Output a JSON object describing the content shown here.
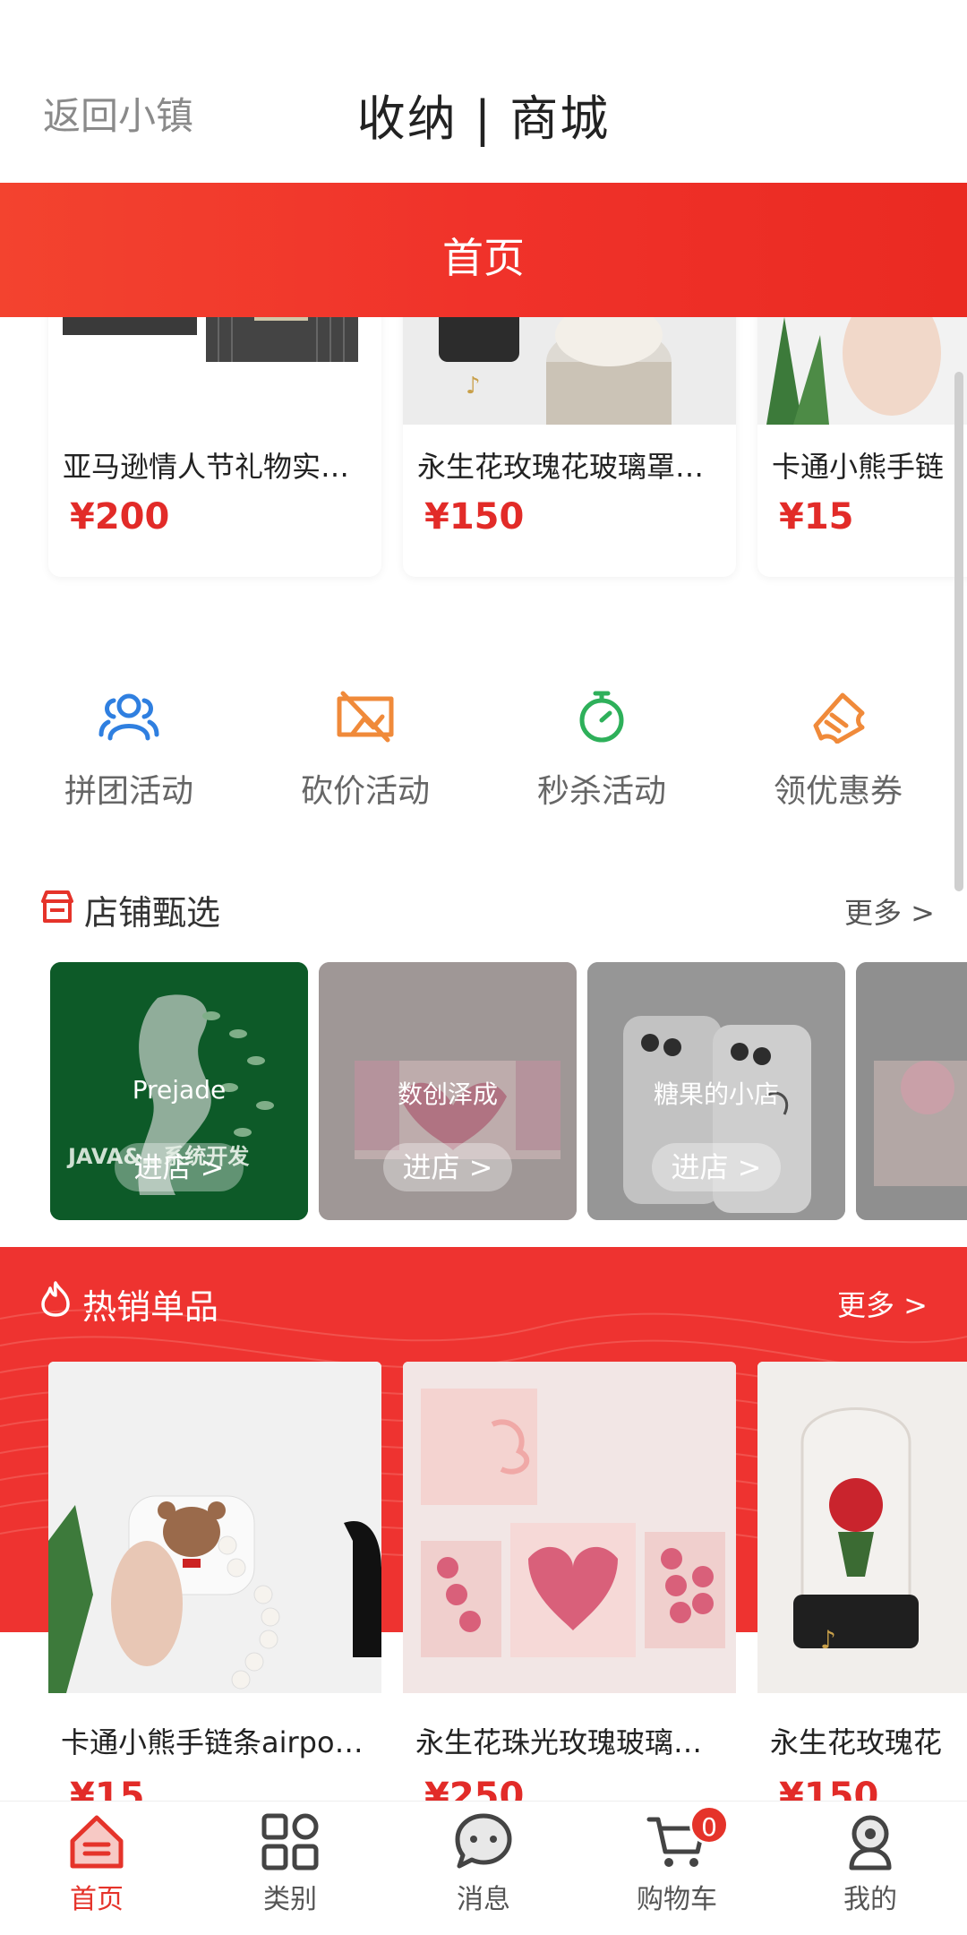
{
  "header": {
    "back_label": "返回小镇",
    "title": "收纳 | 商城",
    "band_title": "首页"
  },
  "top_products": [
    {
      "name": "亚马逊情人节礼物实用...",
      "price": "¥200"
    },
    {
      "name": "永生花玫瑰花玻璃罩成...",
      "price": "¥150"
    },
    {
      "name": "卡通小熊手链",
      "price": "¥15"
    }
  ],
  "quick_actions": [
    {
      "label": "拼团活动",
      "icon": "group-icon",
      "color": "#2f7fe0"
    },
    {
      "label": "砍价活动",
      "icon": "bargain-icon",
      "color": "#f08a3a"
    },
    {
      "label": "秒杀活动",
      "icon": "stopwatch-icon",
      "color": "#2eb05a"
    },
    {
      "label": "领优惠券",
      "icon": "ticket-icon",
      "color": "#f08a3a"
    }
  ],
  "shops": {
    "title": "店铺甄选",
    "more": "更多 >",
    "enter_label": "进店 >",
    "items": [
      {
        "name": "Prejade",
        "watermark": "JAVA&…系统开发"
      },
      {
        "name": "数创泽成"
      },
      {
        "name": "糖果的小店"
      },
      {
        "name": ""
      }
    ]
  },
  "hot": {
    "title": "热销单品",
    "more": "更多 >",
    "items": [
      {
        "name": "卡通小熊手链条airpod...",
        "price": "¥15"
      },
      {
        "name": "永生花珠光玫瑰玻璃罩...",
        "price": "¥250"
      },
      {
        "name": "永生花玫瑰花",
        "price": "¥150"
      }
    ]
  },
  "nav": {
    "items": [
      {
        "label": "首页",
        "icon": "home-icon",
        "active": true
      },
      {
        "label": "类别",
        "icon": "grid-icon"
      },
      {
        "label": "消息",
        "icon": "message-icon"
      },
      {
        "label": "购物车",
        "icon": "cart-icon",
        "badge": "0"
      },
      {
        "label": "我的",
        "icon": "profile-icon"
      }
    ]
  },
  "colors": {
    "brand": "#ef3a2d",
    "price": "#e22b28",
    "nav_active": "#e5332a"
  }
}
